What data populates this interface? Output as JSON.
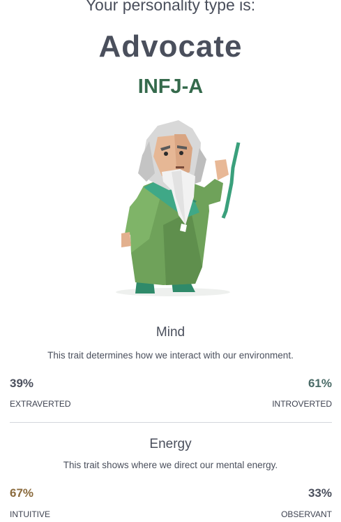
{
  "header": {
    "intro": "Your personality type is:",
    "type_name": "Advocate",
    "type_code": "INFJ-A"
  },
  "illustration": {
    "icon": "advocate-character-illustration"
  },
  "traits": [
    {
      "title": "Mind",
      "description": "This trait determines how we interact with our environment.",
      "left": {
        "percent": "39%",
        "label": "EXTRAVERTED",
        "color": "#4a4f5c"
      },
      "right": {
        "percent": "61%",
        "label": "INTROVERTED",
        "color": "#4a6b67"
      }
    },
    {
      "title": "Energy",
      "description": "This trait shows where we direct our mental energy.",
      "left": {
        "percent": "67%",
        "label": "INTUITIVE",
        "color": "#8a6a3c"
      },
      "right": {
        "percent": "33%",
        "label": "OBSERVANT",
        "color": "#4a4f5c"
      }
    }
  ]
}
